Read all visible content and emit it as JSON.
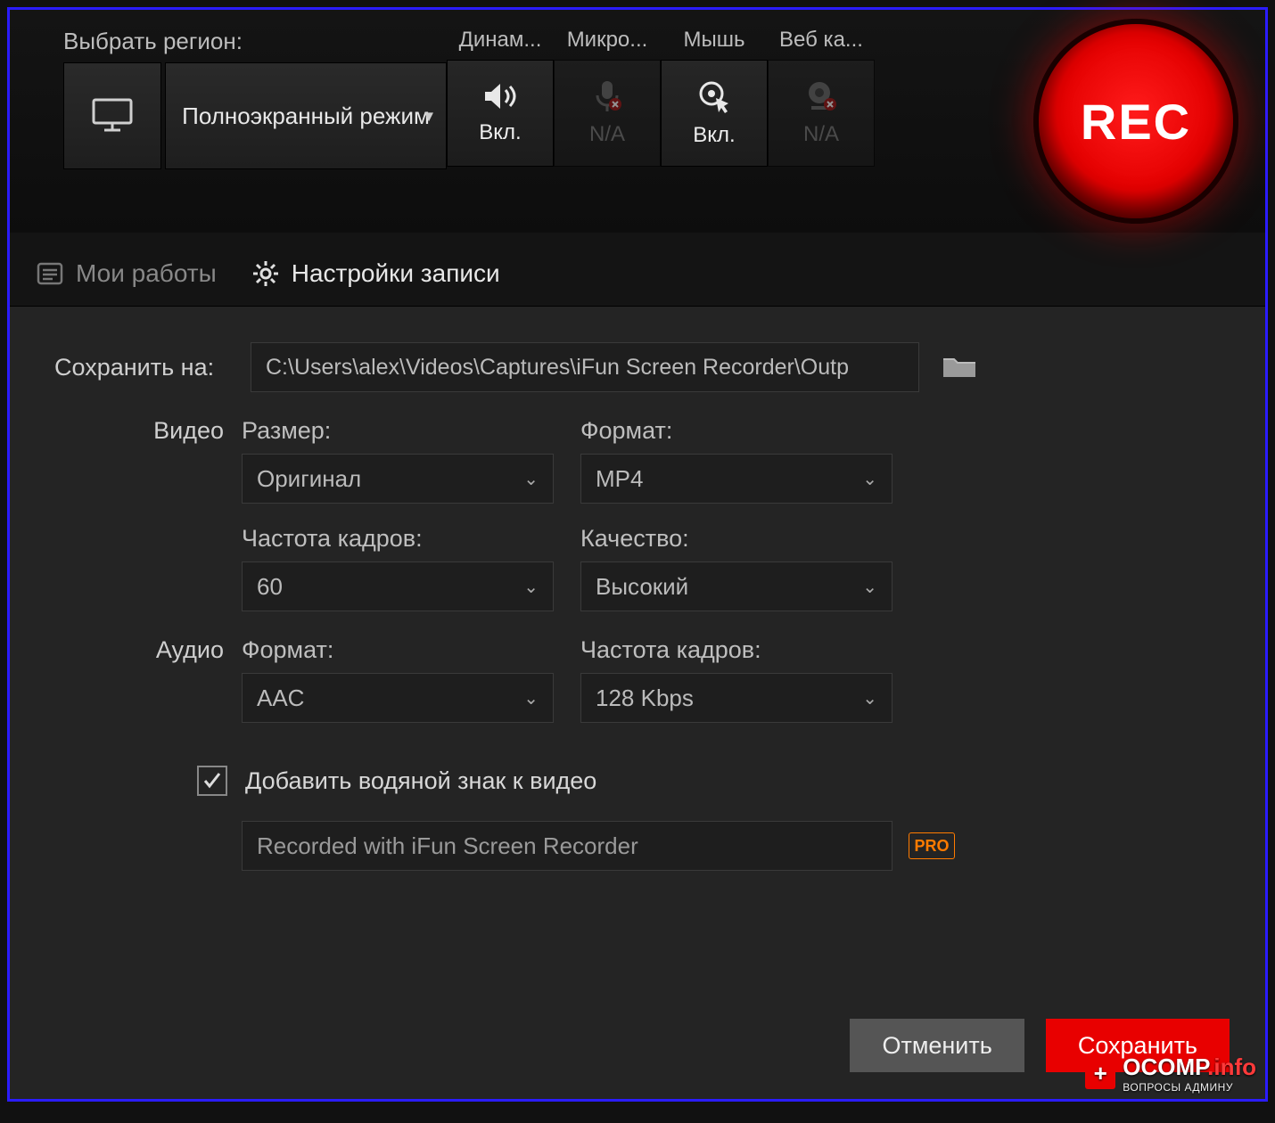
{
  "topbar": {
    "region_label": "Выбрать регион:",
    "region_mode": "Полноэкранный режим",
    "toggles": [
      {
        "header": "Динам...",
        "status": "Вкл.",
        "enabled": true,
        "icon": "speaker-icon"
      },
      {
        "header": "Микро...",
        "status": "N/A",
        "enabled": false,
        "icon": "microphone-icon"
      },
      {
        "header": "Мышь",
        "status": "Вкл.",
        "enabled": true,
        "icon": "cursor-icon"
      },
      {
        "header": "Веб ка...",
        "status": "N/A",
        "enabled": false,
        "icon": "webcam-icon"
      }
    ],
    "rec_label": "REC"
  },
  "tabs": {
    "my_works": "Мои работы",
    "rec_settings": "Настройки записи"
  },
  "settings": {
    "save_to_label": "Сохранить на:",
    "save_path": "C:\\Users\\alex\\Videos\\Captures\\iFun Screen Recorder\\Outp",
    "video_label": "Видео",
    "audio_label": "Аудио",
    "video": {
      "size_label": "Размер:",
      "size_value": "Оригинал",
      "format_label": "Формат:",
      "format_value": "MP4",
      "fps_label": "Частота кадров:",
      "fps_value": "60",
      "quality_label": "Качество:",
      "quality_value": "Высокий"
    },
    "audio": {
      "format_label": "Формат:",
      "format_value": "AAC",
      "bitrate_label": "Частота кадров:",
      "bitrate_value": "128 Kbps"
    },
    "watermark_check_label": "Добавить водяной знак к видео",
    "watermark_text": "Recorded with iFun Screen Recorder",
    "pro_badge": "PRO"
  },
  "footer": {
    "cancel": "Отменить",
    "save": "Сохранить"
  },
  "site_watermark": {
    "name": "OCOMP",
    "suffix": ".info",
    "tagline": "ВОПРОСЫ АДМИНУ"
  }
}
